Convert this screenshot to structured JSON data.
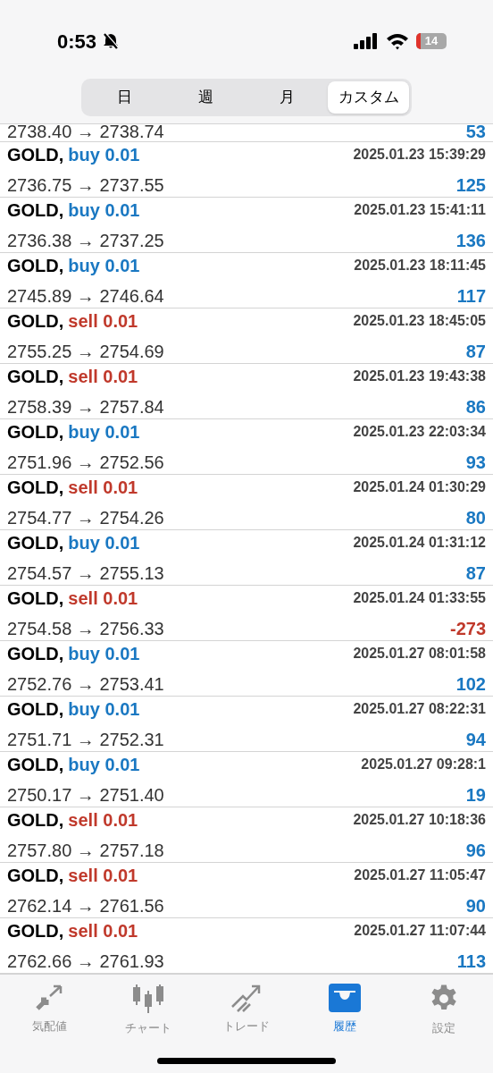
{
  "status_bar": {
    "time": "0:53",
    "battery": "14"
  },
  "segments": [
    {
      "label": "日",
      "selected": false
    },
    {
      "label": "週",
      "selected": false
    },
    {
      "label": "月",
      "selected": false
    },
    {
      "label": "カスタム",
      "selected": true
    }
  ],
  "partial_row": {
    "prices": "2738.40 → 2738.74",
    "profit": "53",
    "color": "#1a78c2"
  },
  "trades": [
    {
      "symbol": "GOLD,",
      "kind": "buy",
      "order": "buy 0.01",
      "time": "2025.01.23 15:39:29",
      "prices": "2736.75 → 2737.55",
      "profit": "125",
      "color": "#1a78c2"
    },
    {
      "symbol": "GOLD,",
      "kind": "buy",
      "order": "buy 0.01",
      "time": "2025.01.23 15:41:11",
      "prices": "2736.38 → 2737.25",
      "profit": "136",
      "color": "#1a78c2"
    },
    {
      "symbol": "GOLD,",
      "kind": "buy",
      "order": "buy 0.01",
      "time": "2025.01.23 18:11:45",
      "prices": "2745.89 → 2746.64",
      "profit": "117",
      "color": "#1a78c2"
    },
    {
      "symbol": "GOLD,",
      "kind": "sell",
      "order": "sell 0.01",
      "time": "2025.01.23 18:45:05",
      "prices": "2755.25 → 2754.69",
      "profit": "87",
      "color": "#1a78c2"
    },
    {
      "symbol": "GOLD,",
      "kind": "sell",
      "order": "sell 0.01",
      "time": "2025.01.23 19:43:38",
      "prices": "2758.39 → 2757.84",
      "profit": "86",
      "color": "#1a78c2"
    },
    {
      "symbol": "GOLD,",
      "kind": "buy",
      "order": "buy 0.01",
      "time": "2025.01.23 22:03:34",
      "prices": "2751.96 → 2752.56",
      "profit": "93",
      "color": "#1a78c2"
    },
    {
      "symbol": "GOLD,",
      "kind": "sell",
      "order": "sell 0.01",
      "time": "2025.01.24 01:30:29",
      "prices": "2754.77 → 2754.26",
      "profit": "80",
      "color": "#1a78c2"
    },
    {
      "symbol": "GOLD,",
      "kind": "buy",
      "order": "buy 0.01",
      "time": "2025.01.24 01:31:12",
      "prices": "2754.57 → 2755.13",
      "profit": "87",
      "color": "#1a78c2"
    },
    {
      "symbol": "GOLD,",
      "kind": "sell",
      "order": "sell 0.01",
      "time": "2025.01.24 01:33:55",
      "prices": "2754.58 → 2756.33",
      "profit": "-273",
      "color": "#c0392b"
    },
    {
      "symbol": "GOLD,",
      "kind": "buy",
      "order": "buy 0.01",
      "time": "2025.01.27 08:01:58",
      "prices": "2752.76 → 2753.41",
      "profit": "102",
      "color": "#1a78c2"
    },
    {
      "symbol": "GOLD,",
      "kind": "buy",
      "order": "buy 0.01",
      "time": "2025.01.27 08:22:31",
      "prices": "2751.71 → 2752.31",
      "profit": "94",
      "color": "#1a78c2"
    },
    {
      "symbol": "GOLD,",
      "kind": "buy",
      "order": "buy 0.01",
      "time": "2025.01.27 09:28:1",
      "prices": "2750.17 → 2751.40",
      "profit": "19",
      "color": "#1a78c2"
    },
    {
      "symbol": "GOLD,",
      "kind": "sell",
      "order": "sell 0.01",
      "time": "2025.01.27 10:18:36",
      "prices": "2757.80 → 2757.18",
      "profit": "96",
      "color": "#1a78c2"
    },
    {
      "symbol": "GOLD,",
      "kind": "sell",
      "order": "sell 0.01",
      "time": "2025.01.27 11:05:47",
      "prices": "2762.14 → 2761.56",
      "profit": "90",
      "color": "#1a78c2"
    },
    {
      "symbol": "GOLD,",
      "kind": "sell",
      "order": "sell 0.01",
      "time": "2025.01.27 11:07:44",
      "prices": "2762.66 → 2761.93",
      "profit": "113",
      "color": "#1a78c2"
    }
  ],
  "tab_bar": [
    {
      "kind": "quotes",
      "label": "気配値",
      "selected": false
    },
    {
      "kind": "chart",
      "label": "チャート",
      "selected": false
    },
    {
      "kind": "trade",
      "label": "トレード",
      "selected": false
    },
    {
      "kind": "history",
      "label": "履歴",
      "selected": true
    },
    {
      "kind": "settings",
      "label": "設定",
      "selected": false
    }
  ]
}
